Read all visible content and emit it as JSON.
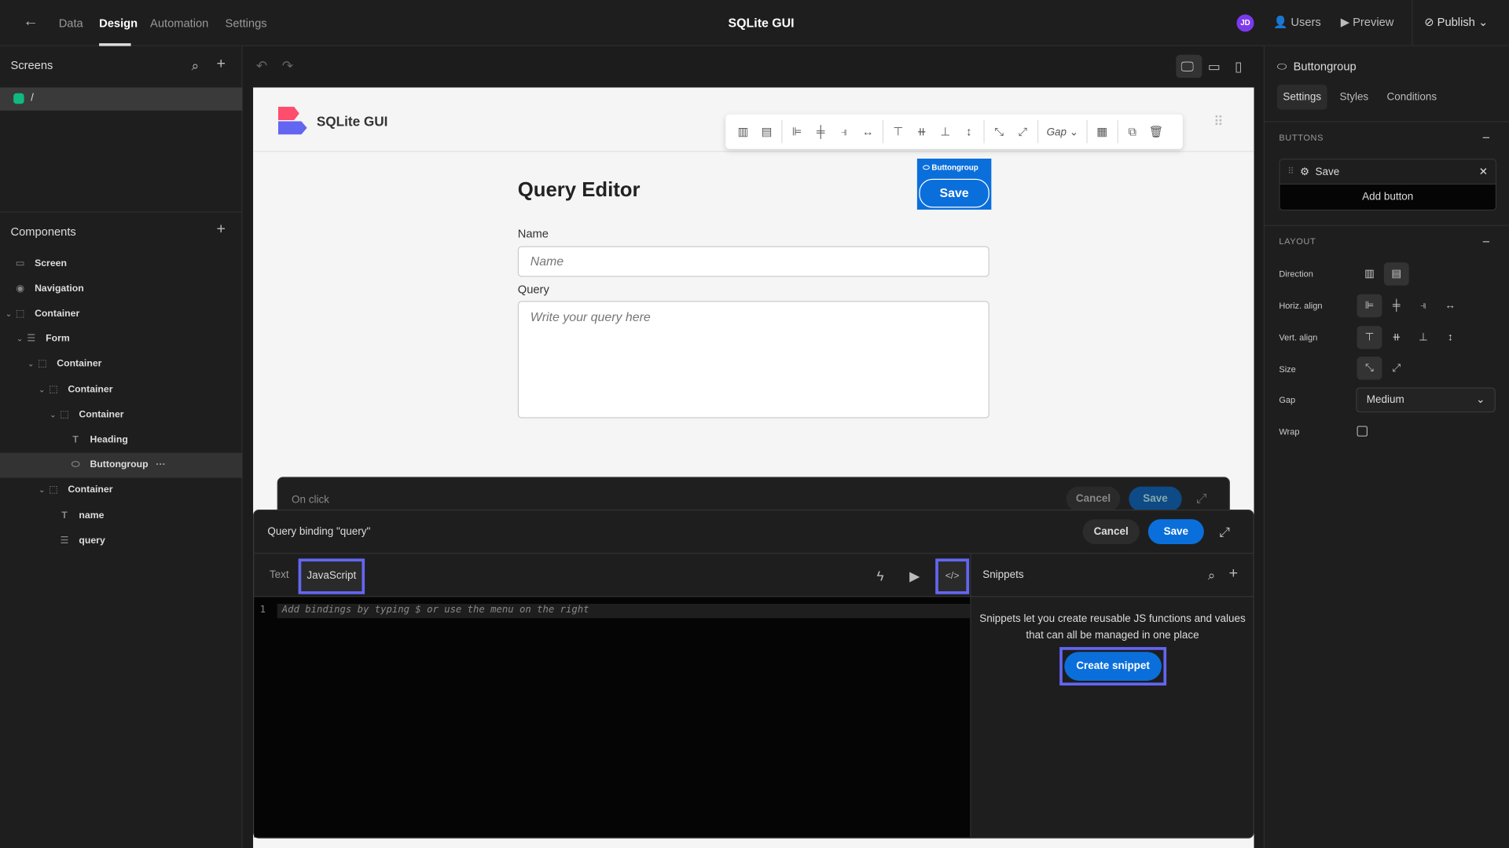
{
  "topbar": {
    "tabs": [
      "Data",
      "Design",
      "Automation",
      "Settings"
    ],
    "active": "Design",
    "title": "SQLite GUI",
    "avatar": "JD",
    "users": "Users",
    "preview": "Preview",
    "publish": "Publish"
  },
  "screens": {
    "title": "Screens",
    "items": [
      "/"
    ]
  },
  "components": {
    "title": "Components",
    "tree": [
      {
        "label": "Screen",
        "icon": "screen-icon",
        "depth": 0
      },
      {
        "label": "Navigation",
        "icon": "eye-icon",
        "depth": 0
      },
      {
        "label": "Container",
        "icon": "container-icon",
        "depth": 0,
        "caret": true
      },
      {
        "label": "Form",
        "icon": "form-icon",
        "depth": 1,
        "caret": true
      },
      {
        "label": "Container",
        "icon": "container-icon",
        "depth": 2,
        "caret": true
      },
      {
        "label": "Container",
        "icon": "container-icon",
        "depth": 3,
        "caret": true
      },
      {
        "label": "Container",
        "icon": "container-icon",
        "depth": 4,
        "caret": true
      },
      {
        "label": "Heading",
        "icon": "text-icon",
        "depth": 5
      },
      {
        "label": "Buttongroup",
        "icon": "buttongroup-icon",
        "depth": 5,
        "selected": true
      },
      {
        "label": "Container",
        "icon": "container-icon",
        "depth": 3,
        "caret": true
      },
      {
        "label": "name",
        "icon": "text-icon",
        "depth": 4
      },
      {
        "label": "query",
        "icon": "form-icon",
        "depth": 4
      }
    ]
  },
  "canvas": {
    "app_title": "SQLite GUI",
    "gap_label": "Gap",
    "heading": "Query Editor",
    "badge": "Buttongroup",
    "save": "Save",
    "name_label": "Name",
    "name_placeholder": "Name",
    "query_label": "Query",
    "query_placeholder": "Write your query here"
  },
  "onclick": {
    "title": "On click",
    "cancel": "Cancel",
    "save": "Save"
  },
  "binding": {
    "title": "Query binding \"query\"",
    "cancel": "Cancel",
    "save": "Save",
    "tabs": [
      "Text",
      "JavaScript"
    ],
    "active_tab": "JavaScript",
    "line_number": "1",
    "code_placeholder": "Add bindings by typing $ or use the menu on the right"
  },
  "snippets": {
    "title": "Snippets",
    "description": "Snippets let you create reusable JS functions and values that can all be managed in one place",
    "create": "Create snippet"
  },
  "right": {
    "component": "Buttongroup",
    "tabs": [
      "Settings",
      "Styles",
      "Conditions"
    ],
    "active_tab": "Settings",
    "buttons_section": "BUTTONS",
    "button_item": "Save",
    "add_button": "Add button",
    "layout_section": "LAYOUT",
    "direction": "Direction",
    "horiz": "Horiz. align",
    "vert": "Vert. align",
    "size": "Size",
    "gap": "Gap",
    "gap_value": "Medium",
    "wrap": "Wrap",
    "wrap_checked": false
  },
  "colors": {
    "accent": "#0a6fdb",
    "highlight": "#6366f1",
    "screen_dot": "#10b981"
  }
}
